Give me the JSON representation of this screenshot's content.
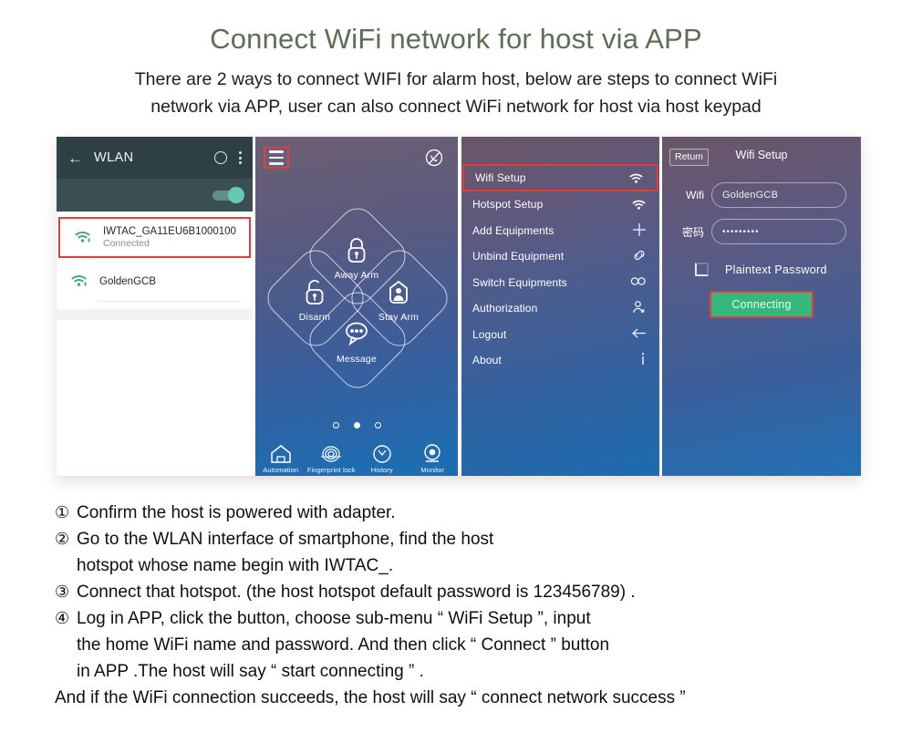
{
  "header": {
    "title": "Connect WiFi network for host via APP",
    "subtitle_line1": "There are 2 ways to connect WIFI for alarm host, below are steps to connect WiFi",
    "subtitle_line2": "network via APP, user can also connect WiFi network for host via host keypad",
    "title_color": "#5d6e52"
  },
  "panel_wlan": {
    "back_icon": "back-arrow-icon",
    "title": "WLAN",
    "recents_icon": "circle-icon",
    "overflow_icon": "more-vertical-icon",
    "wifi_toggle_on": true,
    "networks": [
      {
        "ssid": "IWTAC_GA11EU6B1000100",
        "status": "Connected",
        "highlighted": true
      },
      {
        "ssid": "GoldenGCB",
        "status": "",
        "highlighted": false
      }
    ],
    "highlight_color": "#e23c3c"
  },
  "panel_home": {
    "menu_icon": "hamburger-menu-icon",
    "mute_icon": "mute-notification-icon",
    "actions": [
      {
        "label": "Away Arm",
        "icon": "locked-padlock-icon"
      },
      {
        "label": "Disarm",
        "icon": "unlocked-padlock-icon"
      },
      {
        "label": "Stay Arm",
        "icon": "person-home-icon"
      },
      {
        "label": "Message",
        "icon": "chat-bubble-icon"
      }
    ],
    "pager": {
      "count": 3,
      "active_index": 1
    },
    "tabs": [
      {
        "label": "Automation",
        "icon": "home-icon"
      },
      {
        "label": "Fingerprint lock",
        "icon": "fingerprint-icon"
      },
      {
        "label": "History",
        "icon": "clock-icon"
      },
      {
        "label": "Monitor",
        "icon": "camera-icon"
      }
    ]
  },
  "panel_menu": {
    "items": [
      {
        "label": "Wifi Setup",
        "icon": "wifi-icon",
        "selected": true
      },
      {
        "label": "Hotspot Setup",
        "icon": "wifi-icon",
        "selected": false
      },
      {
        "label": "Add Equipments",
        "icon": "plus-icon",
        "selected": false
      },
      {
        "label": "Unbind Equipment",
        "icon": "link-icon",
        "selected": false
      },
      {
        "label": "Switch Equipments",
        "icon": "infinity-icon",
        "selected": false
      },
      {
        "label": "Authorization",
        "icon": "add-person-icon",
        "selected": false
      },
      {
        "label": "Logout",
        "icon": "left-arrow-icon",
        "selected": false
      },
      {
        "label": "About",
        "icon": "info-icon",
        "selected": false
      }
    ],
    "highlight_color": "#e23c3c"
  },
  "panel_setup": {
    "return_label": "Retum",
    "title": "Wifi Setup",
    "wifi_label": "Wifi",
    "wifi_value": "GoldenGCB",
    "password_label": "密码",
    "password_value": "•••••••••",
    "plaintext_label": "Plaintext Password",
    "plaintext_checked": false,
    "connect_label": "Connecting",
    "connect_color": "#35b87c",
    "highlight_color": "#e23c3c"
  },
  "steps": {
    "s1": {
      "num": "①",
      "text": "Confirm the host is powered with adapter."
    },
    "s2": {
      "num": "②",
      "line1": "Go to the WLAN interface of smartphone, find the host",
      "line2": "hotspot whose name begin with IWTAC_."
    },
    "s3": {
      "num": "③",
      "text": "Connect that hotspot. (the host hotspot default password is 123456789) ."
    },
    "s4": {
      "num": "④",
      "line1": "Log in APP, click the     button, choose sub-menu “ WiFi Setup ”, input",
      "line2": "the home WiFi name and password. And then click “ Connect ”  button",
      "line3": "in APP .The host will say “  start connecting ” ."
    },
    "final": "And if the WiFi connection succeeds, the host will say “ connect network success ”"
  }
}
